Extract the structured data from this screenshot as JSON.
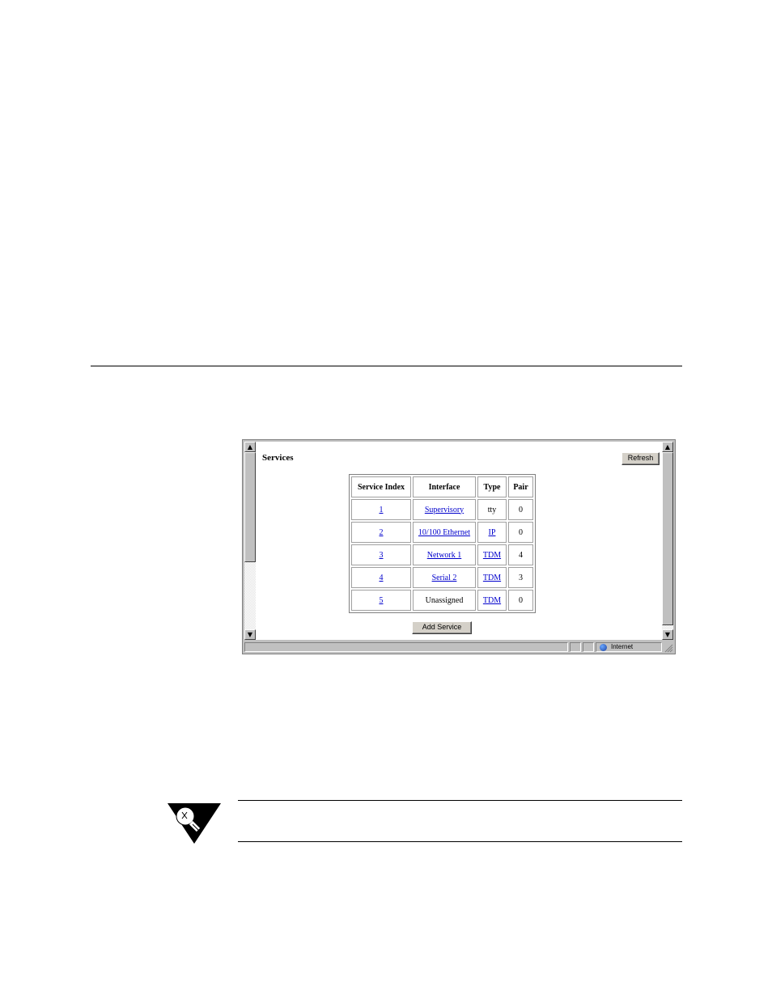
{
  "page": {
    "title": "Services",
    "refresh_label": "Refresh",
    "add_service_label": "Add Service"
  },
  "table": {
    "headers": [
      "Service Index",
      "Interface",
      "Type",
      "Pair"
    ],
    "rows": [
      {
        "index": "1",
        "interface": "Supervisory",
        "type": "tty",
        "pair": "0"
      },
      {
        "index": "2",
        "interface": "10/100 Ethernet",
        "type": "IP",
        "pair": "0"
      },
      {
        "index": "3",
        "interface": "Network 1",
        "type": "TDM",
        "pair": "4"
      },
      {
        "index": "4",
        "interface": "Serial 2",
        "type": "TDM",
        "pair": "3"
      },
      {
        "index": "5",
        "interface": "Unassigned",
        "type": "TDM",
        "pair": "0"
      }
    ]
  },
  "status_bar": {
    "zone": "Internet"
  },
  "icons": {
    "scroll_up": "up-arrow-icon",
    "scroll_down": "down-arrow-icon",
    "zone": "globe-icon",
    "note": "lightbulb-icon"
  }
}
